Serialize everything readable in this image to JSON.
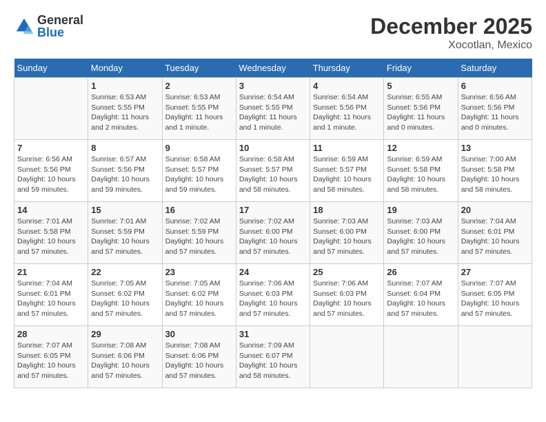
{
  "header": {
    "logo_general": "General",
    "logo_blue": "Blue",
    "month_title": "December 2025",
    "location": "Xocotlan, Mexico"
  },
  "days_of_week": [
    "Sunday",
    "Monday",
    "Tuesday",
    "Wednesday",
    "Thursday",
    "Friday",
    "Saturday"
  ],
  "weeks": [
    [
      {
        "day": "",
        "info": ""
      },
      {
        "day": "1",
        "info": "Sunrise: 6:53 AM\nSunset: 5:55 PM\nDaylight: 11 hours\nand 2 minutes."
      },
      {
        "day": "2",
        "info": "Sunrise: 6:53 AM\nSunset: 5:55 PM\nDaylight: 11 hours\nand 1 minute."
      },
      {
        "day": "3",
        "info": "Sunrise: 6:54 AM\nSunset: 5:55 PM\nDaylight: 11 hours\nand 1 minute."
      },
      {
        "day": "4",
        "info": "Sunrise: 6:54 AM\nSunset: 5:56 PM\nDaylight: 11 hours\nand 1 minute."
      },
      {
        "day": "5",
        "info": "Sunrise: 6:55 AM\nSunset: 5:56 PM\nDaylight: 11 hours\nand 0 minutes."
      },
      {
        "day": "6",
        "info": "Sunrise: 6:56 AM\nSunset: 5:56 PM\nDaylight: 11 hours\nand 0 minutes."
      }
    ],
    [
      {
        "day": "7",
        "info": "Sunrise: 6:56 AM\nSunset: 5:56 PM\nDaylight: 10 hours\nand 59 minutes."
      },
      {
        "day": "8",
        "info": "Sunrise: 6:57 AM\nSunset: 5:56 PM\nDaylight: 10 hours\nand 59 minutes."
      },
      {
        "day": "9",
        "info": "Sunrise: 6:58 AM\nSunset: 5:57 PM\nDaylight: 10 hours\nand 59 minutes."
      },
      {
        "day": "10",
        "info": "Sunrise: 6:58 AM\nSunset: 5:57 PM\nDaylight: 10 hours\nand 58 minutes."
      },
      {
        "day": "11",
        "info": "Sunrise: 6:59 AM\nSunset: 5:57 PM\nDaylight: 10 hours\nand 58 minutes."
      },
      {
        "day": "12",
        "info": "Sunrise: 6:59 AM\nSunset: 5:58 PM\nDaylight: 10 hours\nand 58 minutes."
      },
      {
        "day": "13",
        "info": "Sunrise: 7:00 AM\nSunset: 5:58 PM\nDaylight: 10 hours\nand 58 minutes."
      }
    ],
    [
      {
        "day": "14",
        "info": "Sunrise: 7:01 AM\nSunset: 5:58 PM\nDaylight: 10 hours\nand 57 minutes."
      },
      {
        "day": "15",
        "info": "Sunrise: 7:01 AM\nSunset: 5:59 PM\nDaylight: 10 hours\nand 57 minutes."
      },
      {
        "day": "16",
        "info": "Sunrise: 7:02 AM\nSunset: 5:59 PM\nDaylight: 10 hours\nand 57 minutes."
      },
      {
        "day": "17",
        "info": "Sunrise: 7:02 AM\nSunset: 6:00 PM\nDaylight: 10 hours\nand 57 minutes."
      },
      {
        "day": "18",
        "info": "Sunrise: 7:03 AM\nSunset: 6:00 PM\nDaylight: 10 hours\nand 57 minutes."
      },
      {
        "day": "19",
        "info": "Sunrise: 7:03 AM\nSunset: 6:00 PM\nDaylight: 10 hours\nand 57 minutes."
      },
      {
        "day": "20",
        "info": "Sunrise: 7:04 AM\nSunset: 6:01 PM\nDaylight: 10 hours\nand 57 minutes."
      }
    ],
    [
      {
        "day": "21",
        "info": "Sunrise: 7:04 AM\nSunset: 6:01 PM\nDaylight: 10 hours\nand 57 minutes."
      },
      {
        "day": "22",
        "info": "Sunrise: 7:05 AM\nSunset: 6:02 PM\nDaylight: 10 hours\nand 57 minutes."
      },
      {
        "day": "23",
        "info": "Sunrise: 7:05 AM\nSunset: 6:02 PM\nDaylight: 10 hours\nand 57 minutes."
      },
      {
        "day": "24",
        "info": "Sunrise: 7:06 AM\nSunset: 6:03 PM\nDaylight: 10 hours\nand 57 minutes."
      },
      {
        "day": "25",
        "info": "Sunrise: 7:06 AM\nSunset: 6:03 PM\nDaylight: 10 hours\nand 57 minutes."
      },
      {
        "day": "26",
        "info": "Sunrise: 7:07 AM\nSunset: 6:04 PM\nDaylight: 10 hours\nand 57 minutes."
      },
      {
        "day": "27",
        "info": "Sunrise: 7:07 AM\nSunset: 6:05 PM\nDaylight: 10 hours\nand 57 minutes."
      }
    ],
    [
      {
        "day": "28",
        "info": "Sunrise: 7:07 AM\nSunset: 6:05 PM\nDaylight: 10 hours\nand 57 minutes."
      },
      {
        "day": "29",
        "info": "Sunrise: 7:08 AM\nSunset: 6:06 PM\nDaylight: 10 hours\nand 57 minutes."
      },
      {
        "day": "30",
        "info": "Sunrise: 7:08 AM\nSunset: 6:06 PM\nDaylight: 10 hours\nand 57 minutes."
      },
      {
        "day": "31",
        "info": "Sunrise: 7:09 AM\nSunset: 6:07 PM\nDaylight: 10 hours\nand 58 minutes."
      },
      {
        "day": "",
        "info": ""
      },
      {
        "day": "",
        "info": ""
      },
      {
        "day": "",
        "info": ""
      }
    ]
  ]
}
